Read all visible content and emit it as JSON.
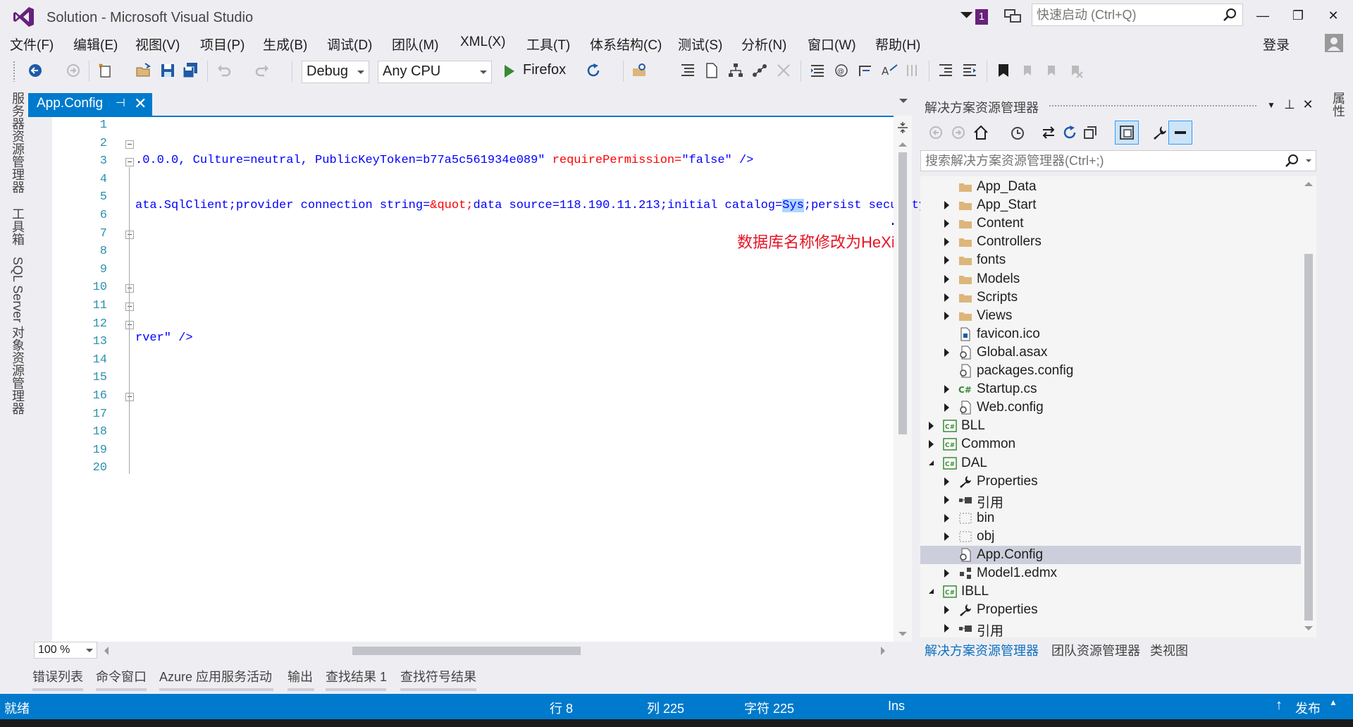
{
  "window": {
    "title": "Solution - Microsoft Visual Studio",
    "notification_count": "1",
    "quick_launch_placeholder": "快速启动 (Ctrl+Q)",
    "sign_in": "登录",
    "minimize": "—",
    "restore": "❐",
    "close": "✕"
  },
  "menu": [
    "文件(F)",
    "编辑(E)",
    "视图(V)",
    "项目(P)",
    "生成(B)",
    "调试(D)",
    "团队(M)",
    "XML(X)",
    "工具(T)",
    "体系结构(C)",
    "测试(S)",
    "分析(N)",
    "窗口(W)",
    "帮助(H)"
  ],
  "toolbar": {
    "configuration": "Debug",
    "platform": "Any CPU",
    "run_target": "Firefox"
  },
  "left_strip": [
    "服务器资源管理器",
    "工具箱",
    "SQL Server 对象资源管理器"
  ],
  "right_strip": "属性",
  "editor": {
    "tab_title": "App.Config",
    "tab_pin": "⊣",
    "tab_close": "✕",
    "zoom": "100 %",
    "line_numbers": [
      "1",
      "2",
      "3",
      "4",
      "5",
      "6",
      "7",
      "8",
      "9",
      "10",
      "11",
      "12",
      "13",
      "14",
      "15",
      "16",
      "17",
      "18",
      "19",
      "20"
    ],
    "line5": {
      "text1": ".0.0.0, Culture=neutral, PublicKeyToken=b77a5c561934e089\"",
      "attr": " requirePermission=",
      "val": "\"false\"",
      "end": " />"
    },
    "line8": {
      "text1": "ata.SqlClient;provider connection string=",
      "entity": "&quot;",
      "text2": "data source=118.190.11.213;initial catalog=",
      "selected": "Sys",
      "text3": ";persist security i"
    },
    "line17": "rver\" />",
    "annotation_prefix": "数据库名称修改为",
    "annotation_value": "HeXiao"
  },
  "solution_explorer": {
    "title": "解决方案资源管理器",
    "search_placeholder": "搜索解决方案资源管理器(Ctrl+;)",
    "tree": [
      {
        "label": "App_Data",
        "icon": "folder-icon",
        "expander": "none"
      },
      {
        "label": "App_Start",
        "icon": "folder-icon",
        "expander": "closed"
      },
      {
        "label": "Content",
        "icon": "folder-icon",
        "expander": "closed"
      },
      {
        "label": "Controllers",
        "icon": "folder-icon",
        "expander": "closed"
      },
      {
        "label": "fonts",
        "icon": "folder-icon",
        "expander": "closed"
      },
      {
        "label": "Models",
        "icon": "folder-icon",
        "expander": "closed"
      },
      {
        "label": "Scripts",
        "icon": "folder-icon",
        "expander": "closed"
      },
      {
        "label": "Views",
        "icon": "folder-icon",
        "expander": "closed"
      },
      {
        "label": "favicon.ico",
        "icon": "file-icon",
        "expander": "none"
      },
      {
        "label": "Global.asax",
        "icon": "config-file-icon",
        "expander": "closed"
      },
      {
        "label": "packages.config",
        "icon": "config-file-icon",
        "expander": "none"
      },
      {
        "label": "Startup.cs",
        "icon": "csharp-file-icon",
        "expander": "closed"
      },
      {
        "label": "Web.config",
        "icon": "config-file-icon",
        "expander": "closed"
      },
      {
        "label": "BLL",
        "icon": "csharp-project-icon",
        "expander": "closed"
      },
      {
        "label": "Common",
        "icon": "csharp-project-icon",
        "expander": "closed"
      },
      {
        "label": "DAL",
        "icon": "csharp-project-icon",
        "expander": "open"
      },
      {
        "label": "Properties",
        "icon": "wrench-icon",
        "expander": "closed"
      },
      {
        "label": "引用",
        "icon": "references-icon",
        "expander": "closed"
      },
      {
        "label": "bin",
        "icon": "dotted-folder-icon",
        "expander": "closed"
      },
      {
        "label": "obj",
        "icon": "dotted-folder-icon",
        "expander": "closed"
      },
      {
        "label": "App.Config",
        "icon": "config-file-icon",
        "expander": "none"
      },
      {
        "label": "Model1.edmx",
        "icon": "edmx-file-icon",
        "expander": "closed"
      },
      {
        "label": "IBLL",
        "icon": "csharp-project-icon",
        "expander": "open"
      },
      {
        "label": "Properties",
        "icon": "wrench-icon",
        "expander": "closed"
      },
      {
        "label": "引用",
        "icon": "references-icon",
        "expander": "closed"
      }
    ],
    "tabs": [
      "解决方案资源管理器",
      "团队资源管理器",
      "类视图"
    ]
  },
  "bottom_tabs": [
    "错误列表",
    "命令窗口",
    "Azure 应用服务活动",
    "输出",
    "查找结果 1",
    "查找符号结果"
  ],
  "status": {
    "ready": "就绪",
    "line": "行 8",
    "col": "列 225",
    "char": "字符 225",
    "mode": "Ins",
    "publish": "发布"
  },
  "colors": {
    "accent": "#007acc",
    "vs_purple": "#68217a",
    "line_number": "#2b91af",
    "xml_attr": "#ff0000",
    "xml_value": "#0000ff",
    "annotation": "#e81123",
    "folder": "#dcb67a"
  }
}
